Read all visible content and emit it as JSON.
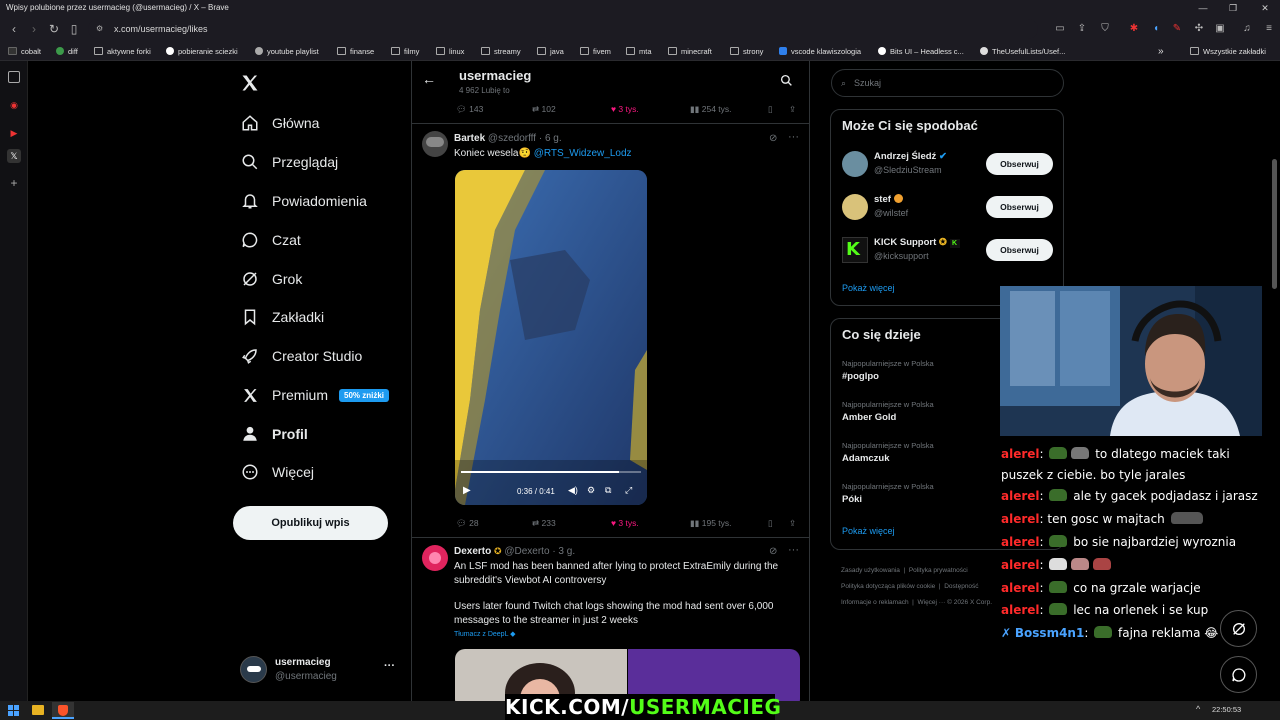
{
  "window": {
    "title": "Wpisy polubione przez usermacieg (@usermacieg) / X – Brave"
  },
  "address": {
    "url": "x.com/usermacieg/likes"
  },
  "bookmarks": [
    {
      "label": "cobalt"
    },
    {
      "label": "diff"
    },
    {
      "label": "aktywne forki"
    },
    {
      "label": "pobieranie sciezki"
    },
    {
      "label": "youtube playlist"
    },
    {
      "label": "finanse"
    },
    {
      "label": "filmy"
    },
    {
      "label": "linux"
    },
    {
      "label": "streamy"
    },
    {
      "label": "java"
    },
    {
      "label": "fivem"
    },
    {
      "label": "mta"
    },
    {
      "label": "minecraft"
    },
    {
      "label": "strony"
    },
    {
      "label": "vscode klawiszologia"
    },
    {
      "label": "Bits UI – Headless c..."
    },
    {
      "label": "TheUsefulLists/Usef..."
    }
  ],
  "bookmarks_all": "Wszystkie zakładki",
  "nav": {
    "items": [
      {
        "label": "Główna",
        "icon": "home-icon"
      },
      {
        "label": "Przeglądaj",
        "icon": "search-icon"
      },
      {
        "label": "Powiadomienia",
        "icon": "bell-icon"
      },
      {
        "label": "Czat",
        "icon": "chat-icon"
      },
      {
        "label": "Grok",
        "icon": "grok-icon"
      },
      {
        "label": "Zakładki",
        "icon": "bookmark-icon"
      },
      {
        "label": "Creator Studio",
        "icon": "rocket-icon"
      },
      {
        "label": "Premium",
        "icon": "x-logo-icon"
      },
      {
        "label": "Profil",
        "icon": "person-icon"
      },
      {
        "label": "Więcej",
        "icon": "more-circle-icon"
      }
    ],
    "premium_badge": "50% zniżki",
    "post_button": "Opublikuj wpis",
    "account": {
      "name": "usermacieg",
      "handle": "@usermacieg",
      "menu": "···"
    }
  },
  "header": {
    "title": "usermacieg",
    "subtitle": "4 962 Lubię to"
  },
  "top_stats": {
    "replies": "143",
    "reposts": "102",
    "likes": "3 tys.",
    "views": "254 tys."
  },
  "post1": {
    "author": "Bartek",
    "handle": "@szedorfff",
    "time": "· 6 g.",
    "text": "Koniec wesela",
    "emoji": "🤨",
    "mention": "@RTS_Widzew_Lodz",
    "video": {
      "time": "0:36 / 0:41",
      "progress": 0.88
    },
    "stats": {
      "replies": "28",
      "reposts": "233",
      "likes": "3 tys.",
      "views": "195 tys."
    }
  },
  "post2": {
    "author": "Dexerto",
    "handle": "@Dexerto",
    "time": "· 3 g.",
    "text1": "An LSF mod has been banned after lying to protect ExtraEmily during the subreddit's Viewbot AI controversy",
    "text2": "Users later found Twitch chat logs showing the mod had sent over 6,000 messages to the streamer in just 2 weeks",
    "translate": "Tłumacz z DeepL"
  },
  "right": {
    "search_placeholder": "Szukaj",
    "suggest_title": "Może Ci się spodobać",
    "suggestions": [
      {
        "name": "Andrzej Śledź",
        "handle": "@SledziuStream",
        "button": "Obserwuj"
      },
      {
        "name": "stef",
        "handle": "@wilstef",
        "button": "Obserwuj"
      },
      {
        "name": "KICK Support",
        "handle": "@kicksupport",
        "button": "Obserwuj"
      }
    ],
    "show_more": "Pokaż więcej",
    "trends_title": "Co się dzieje",
    "trends": [
      {
        "sub": "Najpopularniejsze w Polska",
        "name": "#poglpo"
      },
      {
        "sub": "Najpopularniejsze w Polska",
        "name": "Amber Gold"
      },
      {
        "sub": "Najpopularniejsze w Polska",
        "name": "Adamczuk"
      },
      {
        "sub": "Najpopularniejsze w Polska",
        "name": "Póki"
      }
    ],
    "trends_more": "Pokaż więcej",
    "footer": {
      "l1a": "Zasady użytkowania",
      "l1b": "Polityka prywatności",
      "l2a": "Polityka dotycząca plików cookie",
      "l2b": "Dostępność",
      "l3a": "Informacje o reklamach",
      "l3b": "Więcej ···",
      "copyright": "© 2026 X Corp."
    }
  },
  "chat": [
    {
      "user": "alerel",
      "text": "to dlatego maciek taki"
    },
    {
      "user": "",
      "text": "puszek z ciebie. bo tyle jarales"
    },
    {
      "user": "alerel",
      "text": "ale ty gacek podjadasz i jarasz"
    },
    {
      "user": "alerel",
      "text": "ten gosc w majtach"
    },
    {
      "user": "alerel",
      "text": "bo sie najbardziej wyroznia"
    },
    {
      "user": "alerel",
      "text": ""
    },
    {
      "user": "alerel",
      "text": "co na grzale warjacje"
    },
    {
      "user": "alerel",
      "text": "lec na orlenek i se kup"
    },
    {
      "user": "Bossm4n1",
      "text": "fajna reklama 😂"
    }
  ],
  "overlay": {
    "kick": "KICK.COM/",
    "kick_user": "USERMACIEG"
  },
  "taskbar": {
    "clock": "22:50:53"
  }
}
